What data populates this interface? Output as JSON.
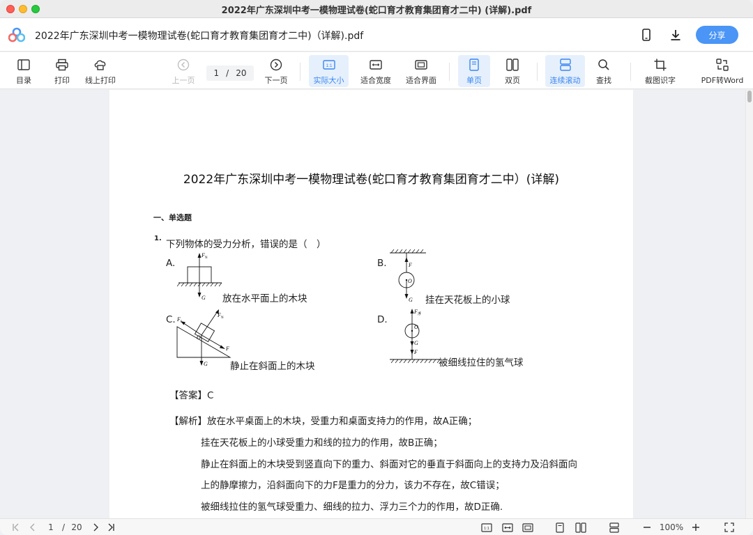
{
  "window": {
    "title": "2022年广东深圳中考一模物理试卷(蛇口育才教育集团育才二中) (详解).pdf"
  },
  "header": {
    "doc_title": "2022年广东深圳中考一模物理试卷(蛇口育才教育集团育才二中)（详解).pdf",
    "share_label": "分享",
    "icons": [
      "phone-icon",
      "download-icon"
    ]
  },
  "toolbar": {
    "toc": "目录",
    "print": "打印",
    "online_print": "线上打印",
    "prev_page": "上一页",
    "page_current": "1",
    "page_sep": "/",
    "page_total": "20",
    "next_page": "下一页",
    "actual_size": "实际大小",
    "fit_width": "适合宽度",
    "fit_page": "适合界面",
    "single_page": "单页",
    "double_page": "双页",
    "continuous": "连续滚动",
    "find": "查找",
    "ocr": "截图识字",
    "pdf_to_word": "PDF转Word"
  },
  "document": {
    "title": "2022年广东深圳中考一模物理试卷(蛇口育才教育集团育才二中）(详解)",
    "section": "一、单选题",
    "question_number": "1.",
    "question_text": "下列物体的受力分析，错误的是（　）",
    "options": [
      {
        "label": "A.",
        "caption": "放在水平面上的木块"
      },
      {
        "label": "B.",
        "caption": "挂在天花板上的小球"
      },
      {
        "label": "C.",
        "caption": "静止在斜面上的木块"
      },
      {
        "label": "D.",
        "caption": "被细线拉住的氢气球"
      }
    ],
    "diagram_labels": {
      "fn": "F",
      "fn_sub": "N",
      "g": "G",
      "f": "F",
      "o": "O",
      "ff": "F",
      "ff_sub": "f",
      "ffu_sub": "浮"
    },
    "answer": "【答案】C",
    "explanation": [
      "【解析】放在水平桌面上的木块，受重力和桌面支持力的作用，故A正确；",
      "挂在天花板上的小球受重力和线的拉力的作用，故B正确；",
      "静止在斜面上的木块受到竖直向下的重力、斜面对它的垂直于斜面向上的支持力及沿斜面向",
      "上的静摩擦力，沿斜面向下的力F是重力的分力，该力不存在，故C错误；",
      "被细线拉住的氢气球受重力、细线的拉力、浮力三个力的作用，故D正确."
    ]
  },
  "statusbar": {
    "page_current": "1",
    "page_sep": "/",
    "page_total": "20",
    "zoom": "100%"
  }
}
